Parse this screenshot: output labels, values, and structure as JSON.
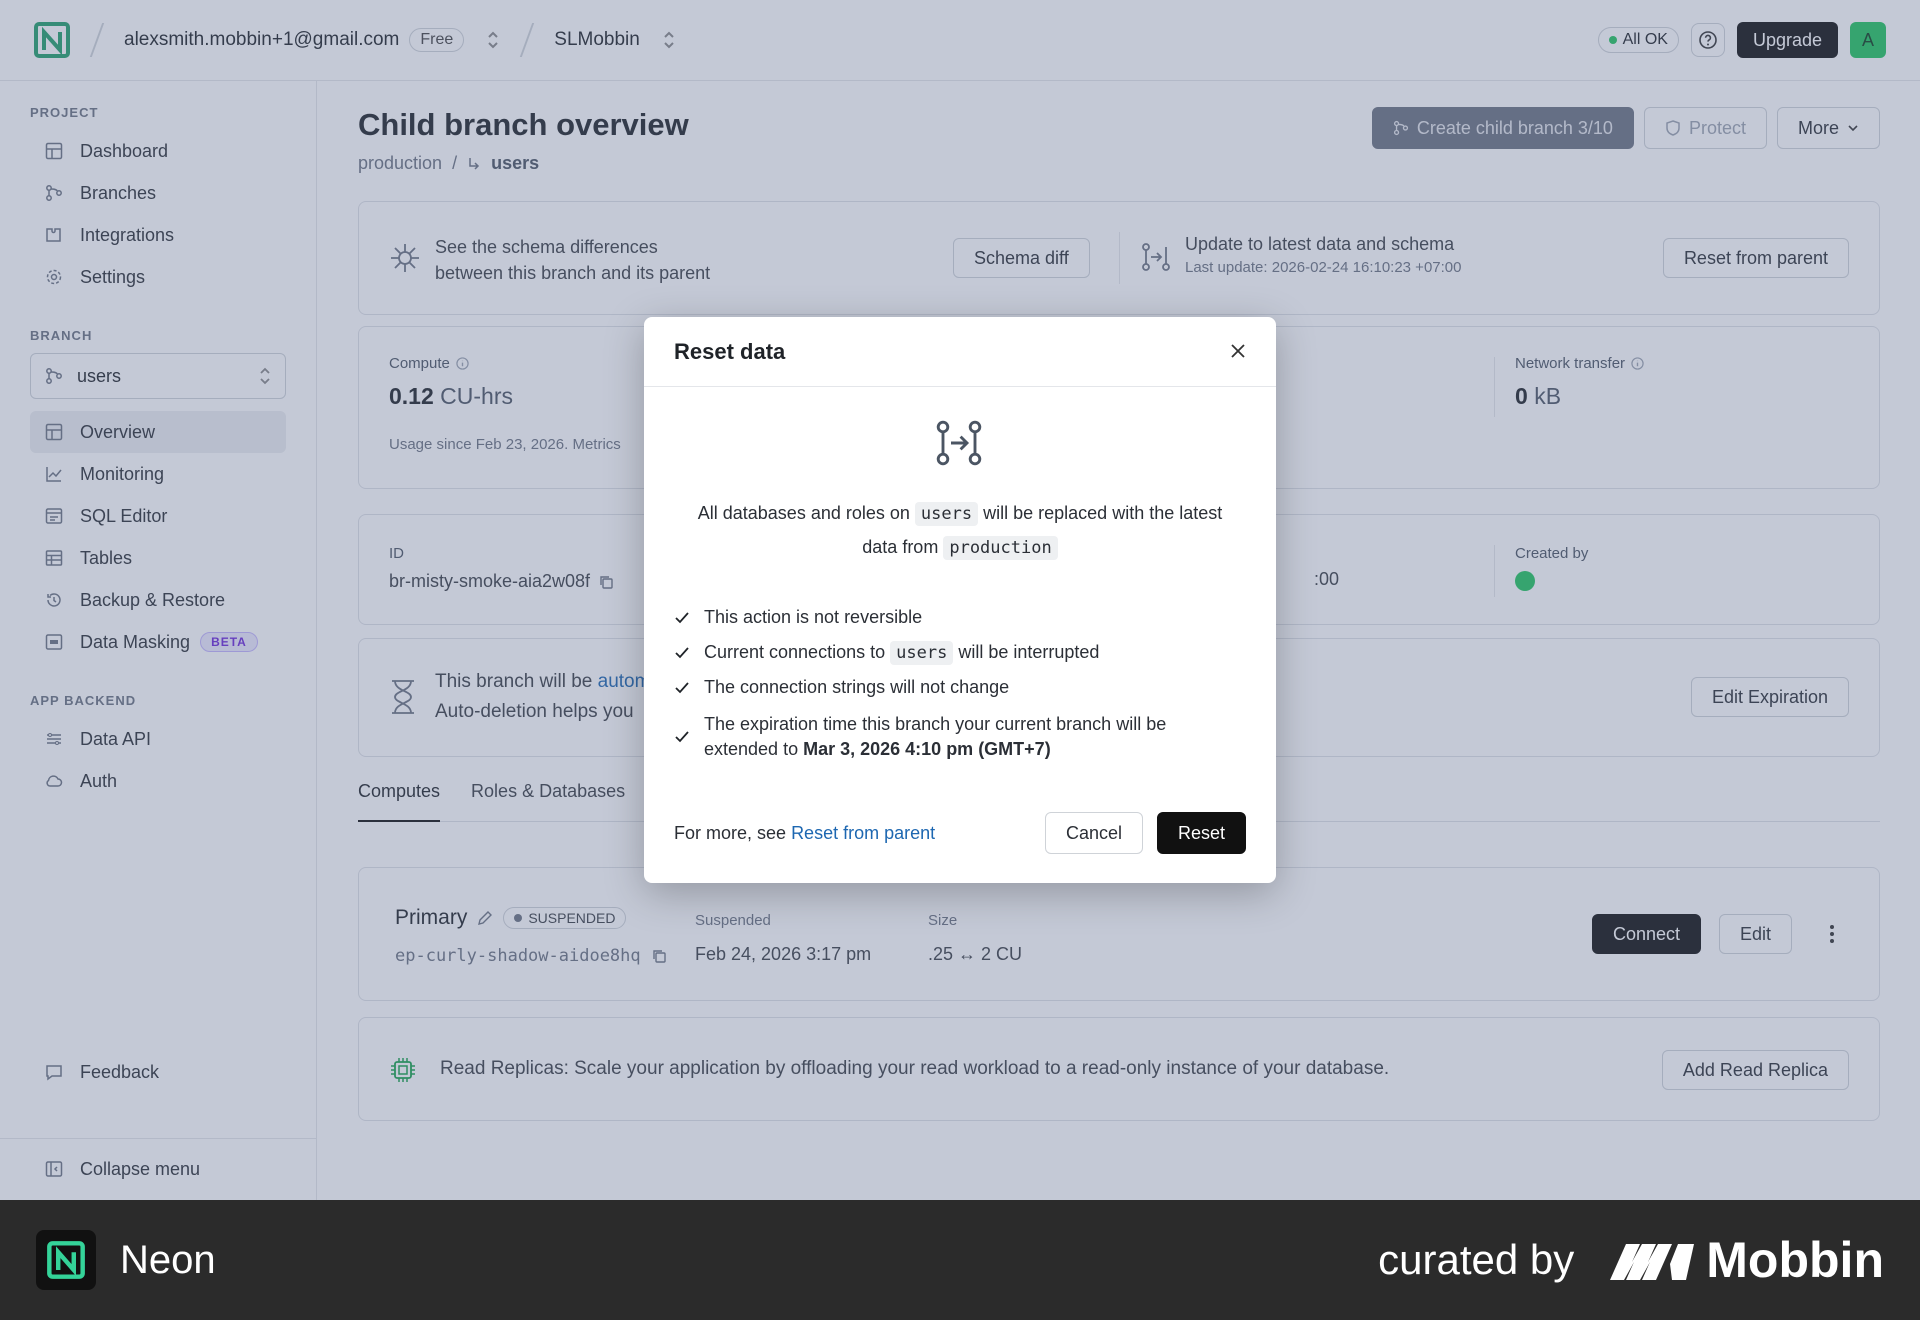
{
  "topbar": {
    "account": "alexsmith.mobbin+1@gmail.com",
    "plan": "Free",
    "project": "SLMobbin",
    "status": "All OK",
    "upgrade": "Upgrade",
    "avatar": "A"
  },
  "sidebar": {
    "project_section": "PROJECT",
    "project_items": [
      {
        "label": "Dashboard",
        "icon": "dashboard-icon"
      },
      {
        "label": "Branches",
        "icon": "branch-icon"
      },
      {
        "label": "Integrations",
        "icon": "puzzle-icon"
      },
      {
        "label": "Settings",
        "icon": "gear-icon"
      }
    ],
    "branch_section": "BRANCH",
    "branch_selected": "users",
    "branch_items": [
      {
        "label": "Overview",
        "icon": "dashboard-icon"
      },
      {
        "label": "Monitoring",
        "icon": "chart-icon"
      },
      {
        "label": "SQL Editor",
        "icon": "editor-icon"
      },
      {
        "label": "Tables",
        "icon": "table-icon"
      },
      {
        "label": "Backup & Restore",
        "icon": "restore-icon"
      },
      {
        "label": "Data Masking",
        "icon": "mask-icon",
        "badge": "BETA"
      }
    ],
    "backend_section": "APP BACKEND",
    "backend_items": [
      {
        "label": "Data API",
        "icon": "api-icon"
      },
      {
        "label": "Auth",
        "icon": "cloud-icon"
      }
    ],
    "feedback": "Feedback",
    "collapse": "Collapse menu"
  },
  "main": {
    "title": "Child branch overview",
    "breadcrumb_parent": "production",
    "breadcrumb_current": "users",
    "create_child": "Create child branch 3/10",
    "protect": "Protect",
    "more": "More",
    "schema_text_1": "See the schema differences",
    "schema_text_2": "between this branch and its parent",
    "schema_diff": "Schema diff",
    "update_title": "Update to latest data and schema",
    "update_sub": "Last update: 2026-02-24 16:10:23 +07:00",
    "reset_parent": "Reset from parent",
    "compute_label": "Compute",
    "compute_value": "0.12",
    "compute_unit": "CU-hrs",
    "usage_since": "Usage since Feb 23, 2026. Metrics",
    "network_label": "Network transfer",
    "network_value": "0",
    "network_unit": "kB",
    "id_label": "ID",
    "id_value": "br-misty-smoke-aia2w08f",
    "created_frag": ":00",
    "created_by": "Created by",
    "expire_text_1": "This branch will be",
    "expire_link": "autom",
    "expire_text_2": "Auto-deletion helps you",
    "edit_expiration": "Edit Expiration",
    "tabs": [
      "Computes",
      "Roles & Databases"
    ],
    "compute_name": "Primary",
    "compute_status": "SUSPENDED",
    "endpoint": "ep-curly-shadow-aidoe8hq",
    "suspended_label": "Suspended",
    "suspended_value": "Feb 24, 2026 3:17 pm",
    "size_label": "Size",
    "size_value": ".25 ↔ 2 CU",
    "connect": "Connect",
    "edit": "Edit",
    "replicas_text": "Read Replicas: Scale your application by offloading your read workload to a read-only instance of your database.",
    "add_replica": "Add Read Replica"
  },
  "modal": {
    "title": "Reset data",
    "desc_1": "All databases and roles on",
    "desc_code_1": "users",
    "desc_2": "will be replaced with the latest",
    "desc_3": "data from",
    "desc_code_2": "production",
    "check_1": "This action is not reversible",
    "check_2a": "Current connections to",
    "check_2_code": "users",
    "check_2b": "will be interrupted",
    "check_3": "The connection strings will not change",
    "check_4a": "The expiration time this branch your current branch will be",
    "check_4b": "extended to",
    "check_4_bold": "Mar 3, 2026 4:10 pm (GMT+7)",
    "footer_text": "For more, see",
    "footer_link": "Reset from parent",
    "cancel": "Cancel",
    "reset": "Reset"
  },
  "footer": {
    "brand": "Neon",
    "curated": "curated by",
    "mobbin": "Mobbin"
  }
}
